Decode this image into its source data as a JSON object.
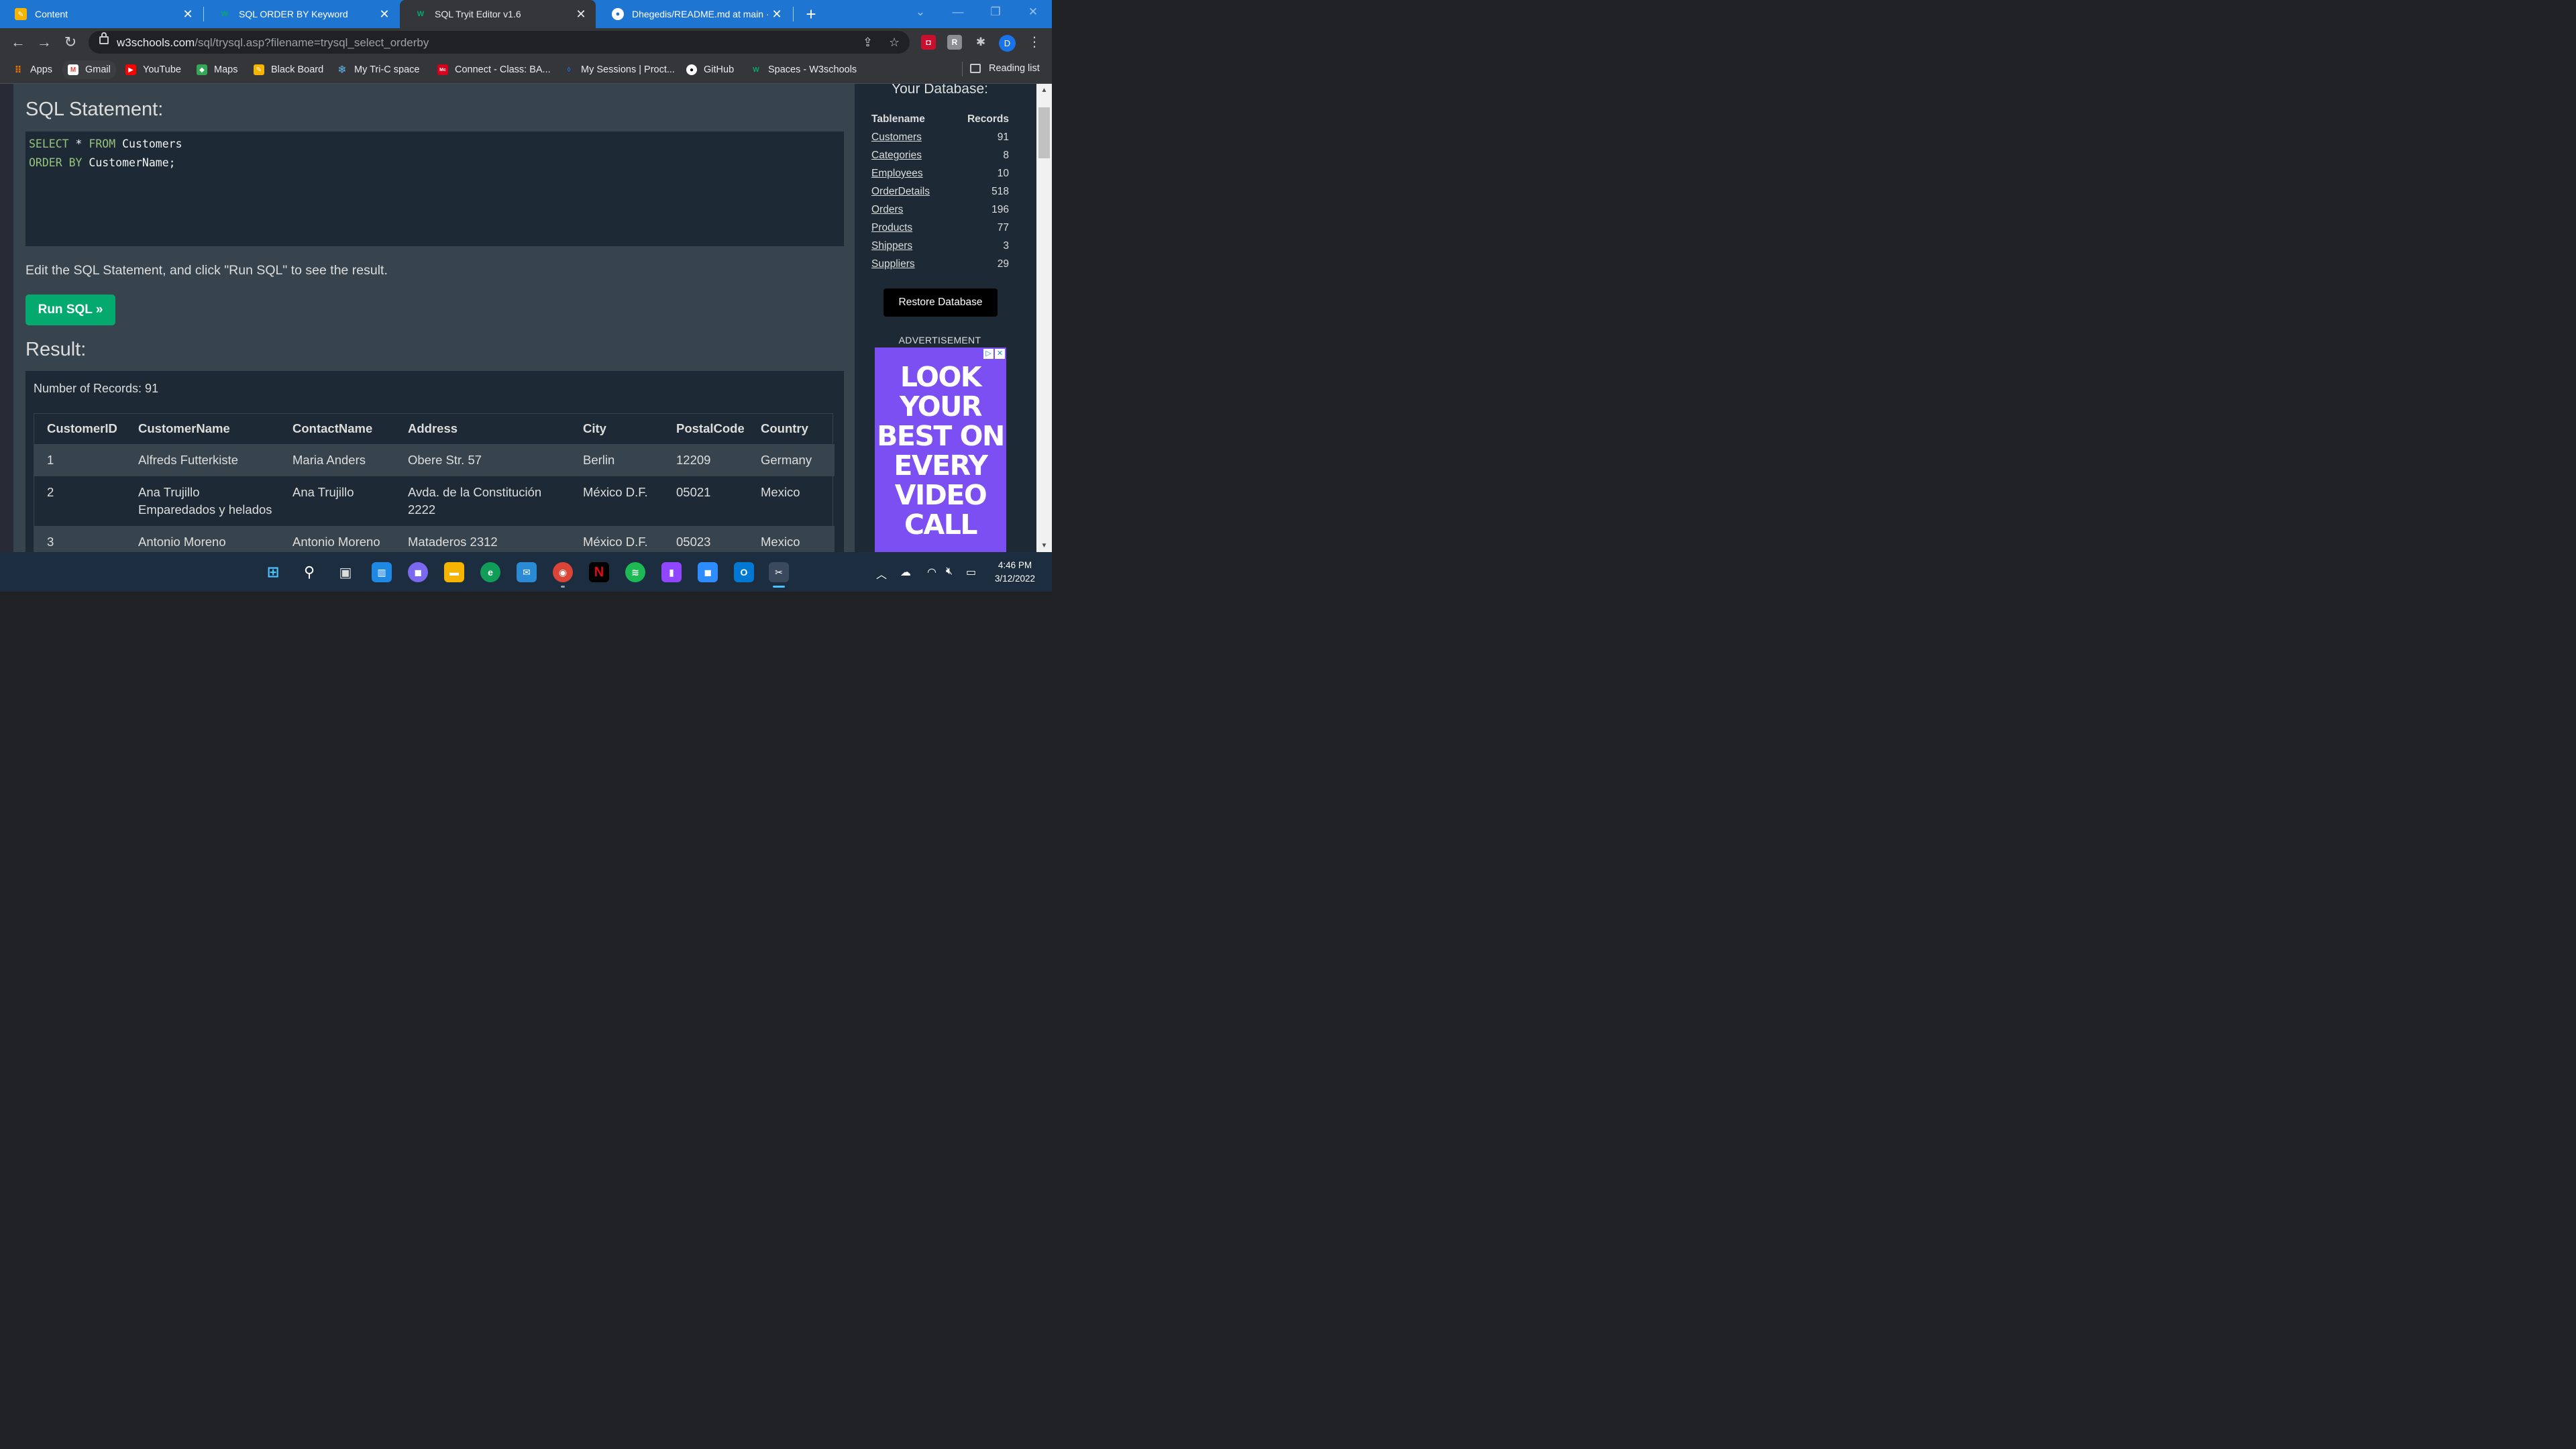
{
  "browser": {
    "tabs": [
      {
        "title": "Content",
        "favicon": "pencil-icon",
        "active": false
      },
      {
        "title": "SQL ORDER BY Keyword",
        "favicon": "w3schools-icon",
        "active": false
      },
      {
        "title": "SQL Tryit Editor v1.6",
        "favicon": "w3schools-icon",
        "active": true
      },
      {
        "title": "Dhegedis/README.md at main · ",
        "favicon": "github-icon",
        "active": false
      }
    ],
    "url_domain": "w3schools.com",
    "url_path": "/sql/trysql.asp?filename=trysql_select_orderby",
    "profile_initial": "D",
    "bookmarks": [
      {
        "label": "Apps",
        "icon": "apps-grid-icon"
      },
      {
        "label": "Gmail",
        "icon": "gmail-icon"
      },
      {
        "label": "YouTube",
        "icon": "youtube-icon"
      },
      {
        "label": "Maps",
        "icon": "maps-icon"
      },
      {
        "label": "Black Board",
        "icon": "pencil-icon"
      },
      {
        "label": "My Tri-C space",
        "icon": "snowflake-icon"
      },
      {
        "label": "Connect - Class: BA...",
        "icon": "mcgraw-hill-icon"
      },
      {
        "label": "My Sessions | Proct...",
        "icon": "proctor-icon"
      },
      {
        "label": "GitHub",
        "icon": "github-icon"
      },
      {
        "label": "Spaces - W3schools",
        "icon": "w3schools-icon"
      }
    ],
    "reading_list": "Reading list"
  },
  "editor": {
    "heading": "SQL Statement:",
    "line1_kw1": "SELECT",
    "line1_rest1": " * ",
    "line1_kw2": "FROM",
    "line1_rest2": " Customers",
    "line2_kw": "ORDER BY",
    "line2_rest": " CustomerName;",
    "hint": "Edit the SQL Statement, and click \"Run SQL\" to see the result.",
    "run_button": "Run SQL »"
  },
  "result": {
    "heading": "Result:",
    "record_count": "Number of Records: 91",
    "columns": [
      "CustomerID",
      "CustomerName",
      "ContactName",
      "Address",
      "City",
      "PostalCode",
      "Country"
    ],
    "rows": [
      [
        "1",
        "Alfreds Futterkiste",
        "Maria Anders",
        "Obere Str. 57",
        "Berlin",
        "12209",
        "Germany"
      ],
      [
        "2",
        "Ana Trujillo Emparedados y helados",
        "Ana Trujillo",
        "Avda. de la Constitución 2222",
        "México D.F.",
        "05021",
        "Mexico"
      ],
      [
        "3",
        "Antonio Moreno",
        "Antonio Moreno",
        "Mataderos 2312",
        "México D.F.",
        "05023",
        "Mexico"
      ]
    ]
  },
  "sidebar": {
    "title": "Your Database:",
    "col_table": "Tablename",
    "col_records": "Records",
    "tables": [
      {
        "name": "Customers",
        "records": "91"
      },
      {
        "name": "Categories",
        "records": "8"
      },
      {
        "name": "Employees",
        "records": "10"
      },
      {
        "name": "OrderDetails",
        "records": "518"
      },
      {
        "name": "Orders",
        "records": "196"
      },
      {
        "name": "Products",
        "records": "77"
      },
      {
        "name": "Shippers",
        "records": "3"
      },
      {
        "name": "Suppliers",
        "records": "29"
      }
    ],
    "restore_button": "Restore Database",
    "ad_label": "ADVERTISEMENT",
    "ad_text": "LOOK YOUR BEST ON EVERY VIDEO CALL"
  },
  "taskbar": {
    "time": "4:46 PM",
    "date": "3/12/2022"
  },
  "colors": {
    "tabstrip": "#1f76d2",
    "accent_green": "#04aa6d",
    "page_main": "#38444d",
    "page_dark": "#1d2a35",
    "ad_purple": "#7b4ff1"
  }
}
